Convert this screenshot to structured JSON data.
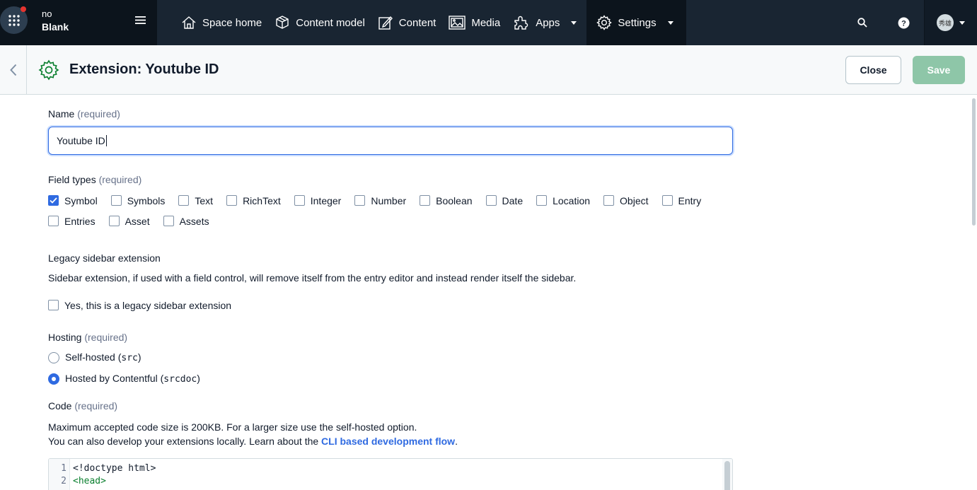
{
  "space": {
    "org": "no",
    "environment": "Blank"
  },
  "nav": {
    "items": [
      {
        "label": "Space home",
        "icon": "home-icon"
      },
      {
        "label": "Content model",
        "icon": "content-model-icon"
      },
      {
        "label": "Content",
        "icon": "content-icon"
      },
      {
        "label": "Media",
        "icon": "media-icon"
      },
      {
        "label": "Apps",
        "icon": "apps-puzzle-icon"
      },
      {
        "label": "Settings",
        "icon": "gear-icon"
      }
    ],
    "avatar_text": "秀雄"
  },
  "header": {
    "title": "Extension: Youtube ID",
    "close_label": "Close",
    "save_label": "Save"
  },
  "form": {
    "name_label": "Name",
    "required": "(required)",
    "name_value": "Youtube ID",
    "field_types_label": "Field types",
    "field_types": [
      {
        "label": "Symbol",
        "checked": true
      },
      {
        "label": "Symbols",
        "checked": false
      },
      {
        "label": "Text",
        "checked": false
      },
      {
        "label": "RichText",
        "checked": false
      },
      {
        "label": "Integer",
        "checked": false
      },
      {
        "label": "Number",
        "checked": false
      },
      {
        "label": "Boolean",
        "checked": false
      },
      {
        "label": "Date",
        "checked": false
      },
      {
        "label": "Location",
        "checked": false
      },
      {
        "label": "Object",
        "checked": false
      },
      {
        "label": "Entry",
        "checked": false
      },
      {
        "label": "Entries",
        "checked": false
      },
      {
        "label": "Asset",
        "checked": false
      },
      {
        "label": "Assets",
        "checked": false
      }
    ],
    "legacy_title": "Legacy sidebar extension",
    "legacy_desc": "Sidebar extension, if used with a field control, will remove itself from the entry editor and instead render itself the sidebar.",
    "legacy_checkbox_label": "Yes, this is a legacy sidebar extension",
    "hosting_label": "Hosting",
    "hosting_self_text": "Self-hosted (",
    "hosting_self_code": "src",
    "hosting_contentful_text": "Hosted by Contentful (",
    "hosting_contentful_code": "srcdoc",
    "close_paren": ")",
    "code_label": "Code",
    "code_desc_1": "Maximum accepted code size is 200KB. For a larger size use the self-hosted option.",
    "code_desc_2": "You can also develop your extensions locally. Learn about the ",
    "code_link": "CLI based development flow",
    "code_period": ".",
    "code_lines": [
      "<!doctype html>",
      "<head>"
    ],
    "line_numbers": [
      "1",
      "2"
    ]
  },
  "colors": {
    "topnav_bg": "#192532",
    "primary_blue": "#2f6ae1",
    "save_green": "#8ec6a8",
    "settings_icon_green": "#0a7f2e"
  }
}
